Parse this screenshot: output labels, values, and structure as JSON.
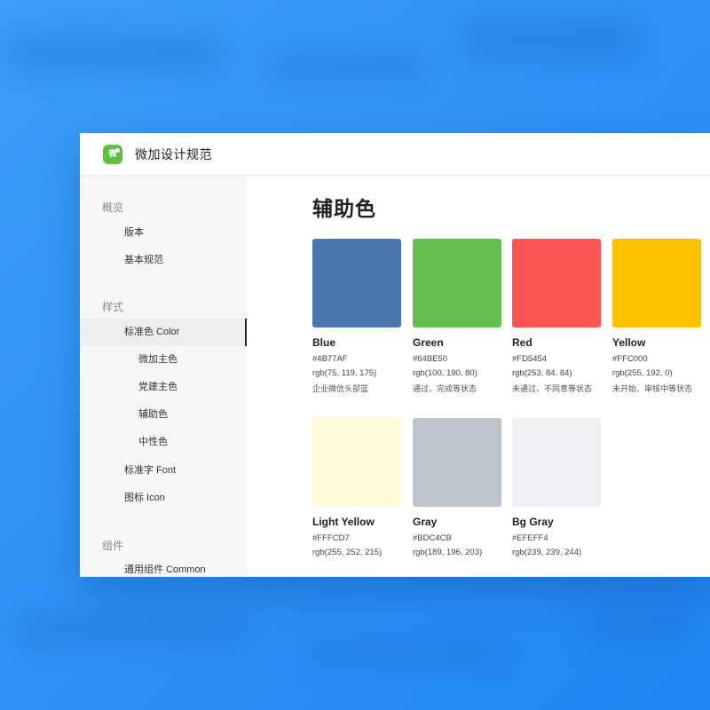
{
  "app": {
    "title": "微加设计规范",
    "logo_text": "微"
  },
  "sidebar": {
    "groups": [
      {
        "label": "概览",
        "items": [
          {
            "label": "版本"
          },
          {
            "label": "基本规范"
          }
        ]
      },
      {
        "label": "样式",
        "items": [
          {
            "label": "标准色 Color",
            "active": true
          },
          {
            "label": "微加主色"
          },
          {
            "label": "党建主色"
          },
          {
            "label": "辅助色"
          },
          {
            "label": "中性色"
          },
          {
            "label": "标准字 Font"
          },
          {
            "label": "图标 Icon"
          }
        ]
      },
      {
        "label": "组件",
        "items": [
          {
            "label": "通用组件 Common"
          }
        ]
      }
    ]
  },
  "main": {
    "title": "辅助色",
    "swatches": [
      {
        "name": "Blue",
        "hex": "#4B77AF",
        "rgb": "rgb(75, 119, 175)",
        "desc": "企业微信头部蓝",
        "color": "#4B77AF"
      },
      {
        "name": "Green",
        "hex": "#64BE50",
        "rgb": "rgb(100, 190, 80)",
        "desc": "通过、完成等状态",
        "color": "#64BE50"
      },
      {
        "name": "Red",
        "hex": "#FD5454",
        "rgb": "rgb(253, 84, 84)",
        "desc": "未通过、不同意等状态",
        "color": "#FD5454"
      },
      {
        "name": "Yellow",
        "hex": "#FFC000",
        "rgb": "rgb(255, 192, 0)",
        "desc": "未开始、审核中等状态",
        "color": "#FFC000"
      },
      {
        "name": "Light Yellow",
        "hex": "#FFFCD7",
        "rgb": "rgb(255, 252, 215)",
        "desc": "",
        "color": "#FFFCD7"
      },
      {
        "name": "Gray",
        "hex": "#BDC4CB",
        "rgb": "rgb(189, 196, 203)",
        "desc": "",
        "color": "#BDC4CB"
      },
      {
        "name": "Bg Gray",
        "hex": "#EFEFF4",
        "rgb": "rgb(239, 239, 244)",
        "desc": "",
        "color": "#EFEFF4"
      }
    ]
  }
}
